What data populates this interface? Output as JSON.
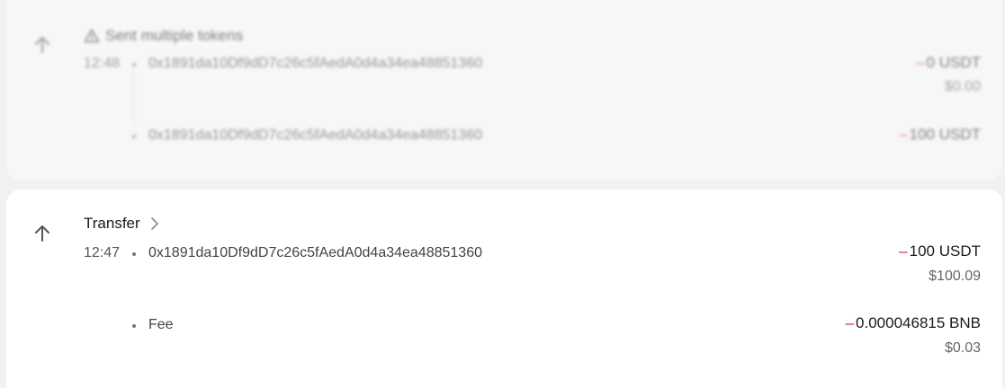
{
  "tx_multi": {
    "title": "Sent multiple tokens",
    "time": "12:48",
    "rows": [
      {
        "address": "0x1891da10Df9dD7c26c5fAedA0d4a34ea48851360",
        "minus": "–",
        "amount": "0 USDT",
        "fiat": "$0.00"
      },
      {
        "address": "0x1891da10Df9dD7c26c5fAedA0d4a34ea48851360",
        "minus": "–",
        "amount": "100 USDT"
      }
    ],
    "icons": {
      "direction": "arrow-up-icon",
      "status": "warning-icon"
    }
  },
  "tx_transfer": {
    "title": "Transfer",
    "time": "12:47",
    "address": "0x1891da10Df9dD7c26c5fAedA0d4a34ea48851360",
    "minus": "–",
    "amount": "100 USDT",
    "fiat": "$100.09",
    "fee": {
      "label": "Fee",
      "minus": "–",
      "amount": "0.000046815 BNB",
      "fiat": "$0.03"
    },
    "icons": {
      "direction": "arrow-up-icon",
      "detail": "chevron-right-icon"
    }
  },
  "colors": {
    "negative": "#d21c3c",
    "card_muted": "#f7f7f7",
    "card": "#ffffff",
    "background": "#f1f1f1"
  }
}
